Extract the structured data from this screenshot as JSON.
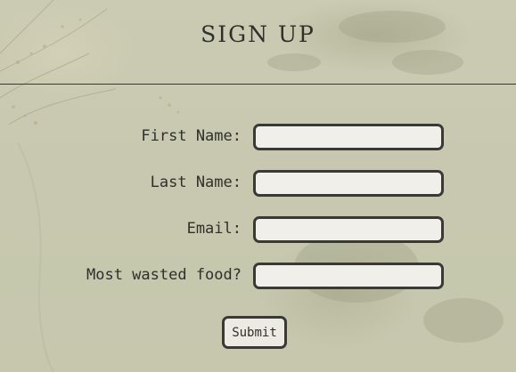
{
  "header": {
    "title": "SIGN UP"
  },
  "form": {
    "fields": [
      {
        "label": "First Name:",
        "value": ""
      },
      {
        "label": "Last Name:",
        "value": ""
      },
      {
        "label": "Email:",
        "value": ""
      },
      {
        "label": "Most wasted food?",
        "value": ""
      }
    ],
    "submit_label": "Submit"
  },
  "colors": {
    "background": "#c8c9b0",
    "text": "#2f2f2c",
    "field_background": "#f0efea",
    "border": "#393936"
  }
}
